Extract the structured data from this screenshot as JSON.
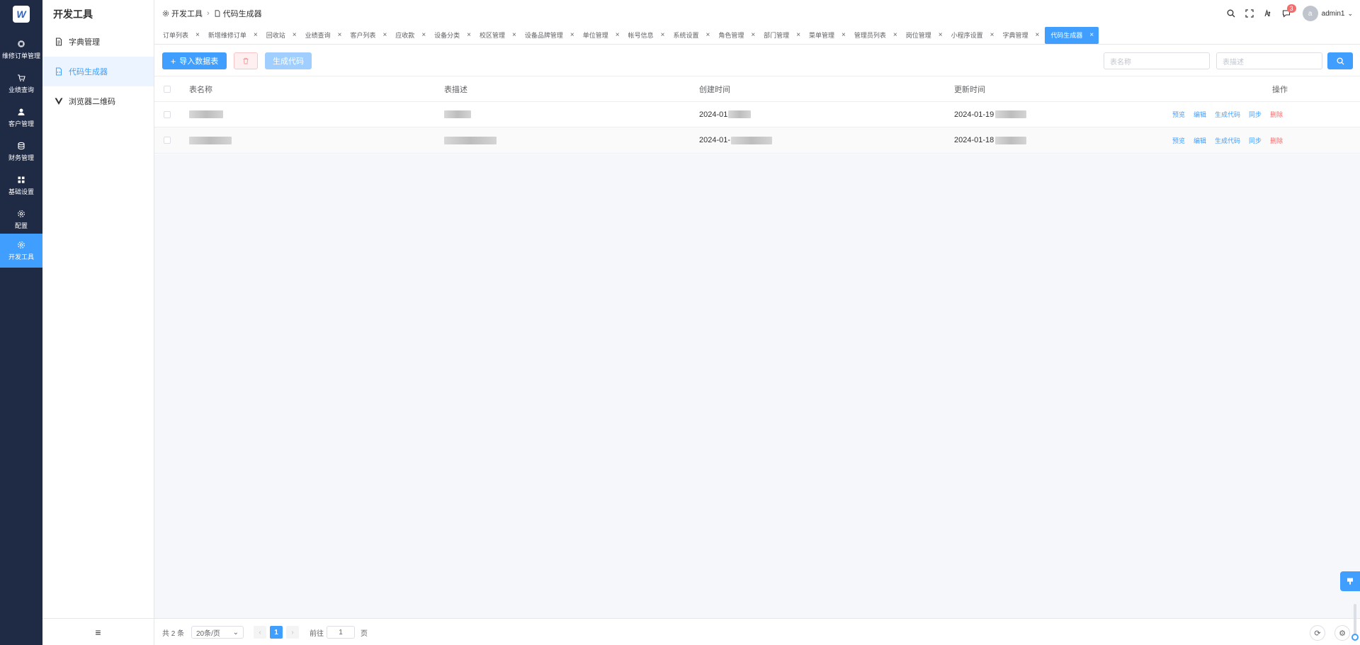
{
  "rail": {
    "logo": "W",
    "items": [
      {
        "label": "维修订单管理",
        "icon": "chip-icon"
      },
      {
        "label": "业绩查询",
        "icon": "cart-icon"
      },
      {
        "label": "客户管理",
        "icon": "user-icon"
      },
      {
        "label": "财务管理",
        "icon": "database-icon"
      },
      {
        "label": "基础设置",
        "icon": "grid-icon"
      },
      {
        "label": "配置",
        "icon": "gear-icon"
      },
      {
        "label": "开发工具",
        "icon": "gear-icon"
      }
    ]
  },
  "submenu": {
    "title": "开发工具",
    "items": [
      {
        "label": "字典管理"
      },
      {
        "label": "代码生成器"
      },
      {
        "label": "浏览器二维码"
      }
    ]
  },
  "breadcrumb": {
    "root": "开发工具",
    "current": "代码生成器"
  },
  "header": {
    "badge": "3",
    "user": "admin1",
    "avatar": "a"
  },
  "tabs": [
    "订单列表",
    "新增维修订单",
    "回收站",
    "业绩查询",
    "客户列表",
    "应收款",
    "设备分类",
    "校区管理",
    "设备品牌管理",
    "单位管理",
    "帐号信息",
    "系统设置",
    "角色管理",
    "部门管理",
    "菜单管理",
    "管理员列表",
    "岗位管理",
    "小程序设置",
    "字典管理",
    "代码生成器"
  ],
  "toolbar": {
    "import_label": "导入数据表",
    "generate_label": "生成代码",
    "search_name_placeholder": "表名称",
    "search_desc_placeholder": "表描述"
  },
  "table": {
    "headers": {
      "name": "表名称",
      "desc": "表描述",
      "created": "创建时间",
      "updated": "更新时间",
      "ops": "操作"
    },
    "rows": [
      {
        "created": "2024-01",
        "updated": "2024-01-19"
      },
      {
        "created": "2024-01-",
        "updated": "2024-01-18"
      }
    ],
    "ops": {
      "preview": "预览",
      "edit": "编辑",
      "generate": "生成代码",
      "sync": "同步",
      "delete": "删除"
    }
  },
  "pagination": {
    "total": "共 2 条",
    "page_size": "20条/页",
    "current": "1",
    "goto": "前往",
    "goto_value": "1",
    "unit": "页"
  },
  "colors": {
    "primary": "#409eff",
    "rail": "#1f2a44",
    "danger": "#f56c6c"
  }
}
